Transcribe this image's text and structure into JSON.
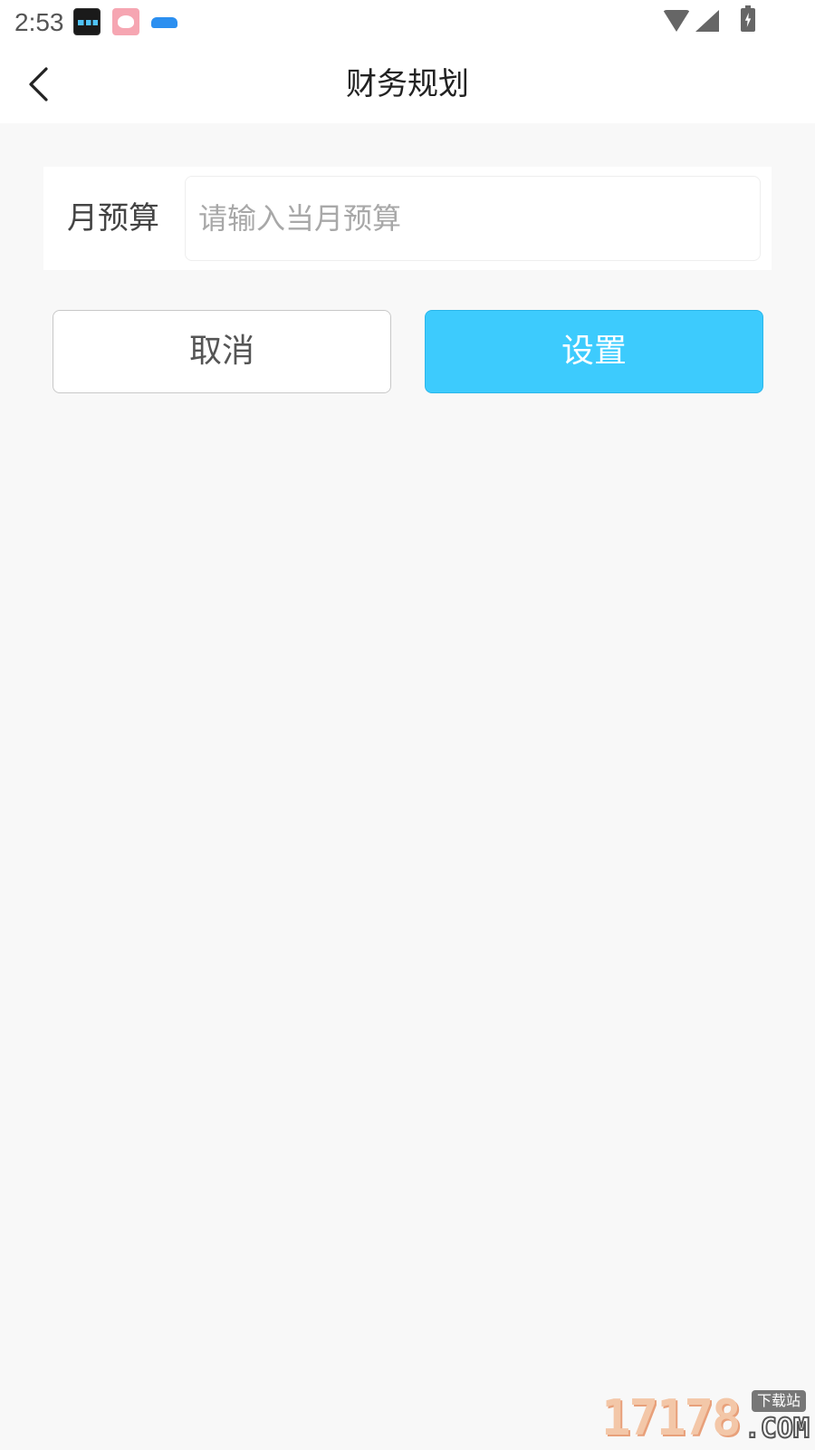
{
  "status_bar": {
    "time": "2:53",
    "notification_icons": [
      "clock-widget-icon",
      "rice-bowl-icon",
      "car-icon"
    ],
    "system_icons": [
      "wifi-icon",
      "signal-icon",
      "battery-charging-icon"
    ]
  },
  "header": {
    "title": "财务规划",
    "back_icon": "chevron-left-icon"
  },
  "budget": {
    "label": "月预算",
    "value": "",
    "placeholder": "请输入当月预算"
  },
  "actions": {
    "cancel_label": "取消",
    "set_label": "设置"
  },
  "watermark": {
    "number": "17178",
    "domain": ".COM",
    "badge": "下载站"
  },
  "colors": {
    "primary": "#3dcbfd",
    "page_background": "#f8f8f8",
    "card_background": "#ffffff"
  }
}
